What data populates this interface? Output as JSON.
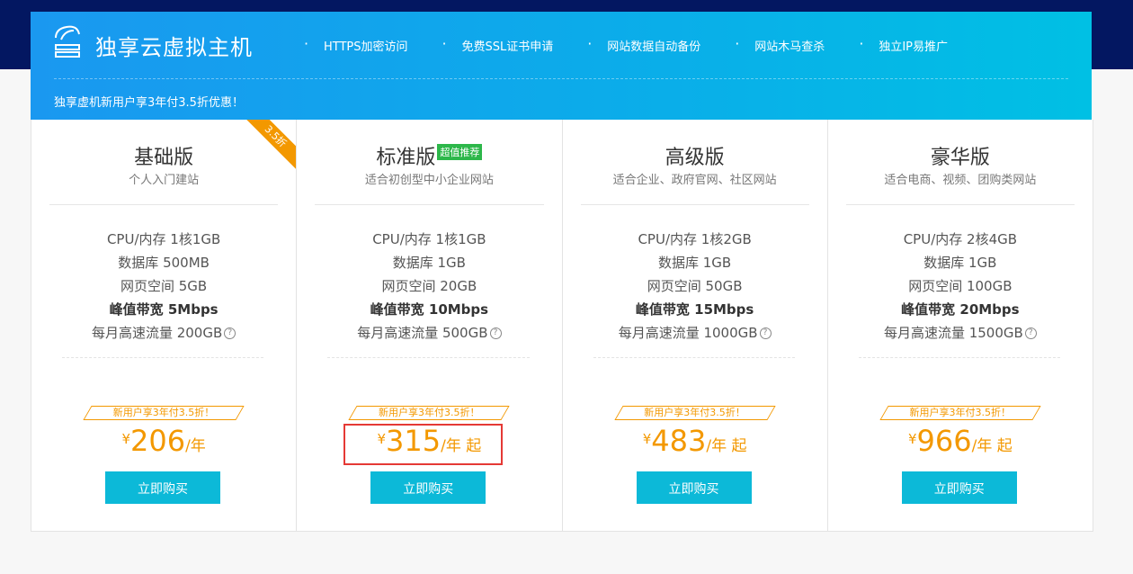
{
  "header": {
    "brand": "独享云虚拟主机",
    "features": [
      "HTTPS加密访问",
      "免费SSL证书申请",
      "网站数据自动备份",
      "网站木马查杀",
      "独立IP易推广"
    ],
    "promo": "独享虚机新用户享3年付3.5折优惠！"
  },
  "plans": [
    {
      "name": "基础版",
      "ribbon": "3.5折",
      "desc": "个人入门建站",
      "specs": [
        "CPU/内存 1核1GB",
        "数据库 500MB",
        "网页空间 5GB",
        "峰值带宽 5Mbps",
        "每月高速流量 200GB"
      ],
      "discount": "新用户享3年付3.5折！",
      "currency": "¥",
      "price": "206",
      "unit": "/年",
      "button": "立即购买"
    },
    {
      "name": "标准版",
      "badge": "超值推荐",
      "desc": "适合初创型中小企业网站",
      "specs": [
        "CPU/内存 1核1GB",
        "数据库 1GB",
        "网页空间 20GB",
        "峰值带宽 10Mbps",
        "每月高速流量 500GB"
      ],
      "discount": "新用户享3年付3.5折！",
      "currency": "¥",
      "price": "315",
      "unit": "/年 起",
      "button": "立即购买"
    },
    {
      "name": "高级版",
      "desc": "适合企业、政府官网、社区网站",
      "specs": [
        "CPU/内存 1核2GB",
        "数据库 1GB",
        "网页空间 50GB",
        "峰值带宽 15Mbps",
        "每月高速流量 1000GB"
      ],
      "discount": "新用户享3年付3.5折！",
      "currency": "¥",
      "price": "483",
      "unit": "/年 起",
      "button": "立即购买"
    },
    {
      "name": "豪华版",
      "desc": "适合电商、视频、团购类网站",
      "specs": [
        "CPU/内存 2核4GB",
        "数据库 1GB",
        "网页空间 100GB",
        "峰值带宽 20Mbps",
        "每月高速流量 1500GB"
      ],
      "discount": "新用户享3年付3.5折！",
      "currency": "¥",
      "price": "966",
      "unit": "/年 起",
      "button": "立即购买"
    }
  ],
  "help_glyph": "?",
  "colors": {
    "accent": "#f39800",
    "button": "#0cb9d8",
    "badge": "#2db74a",
    "highlight": "#e53935",
    "top_band": "#031761"
  }
}
